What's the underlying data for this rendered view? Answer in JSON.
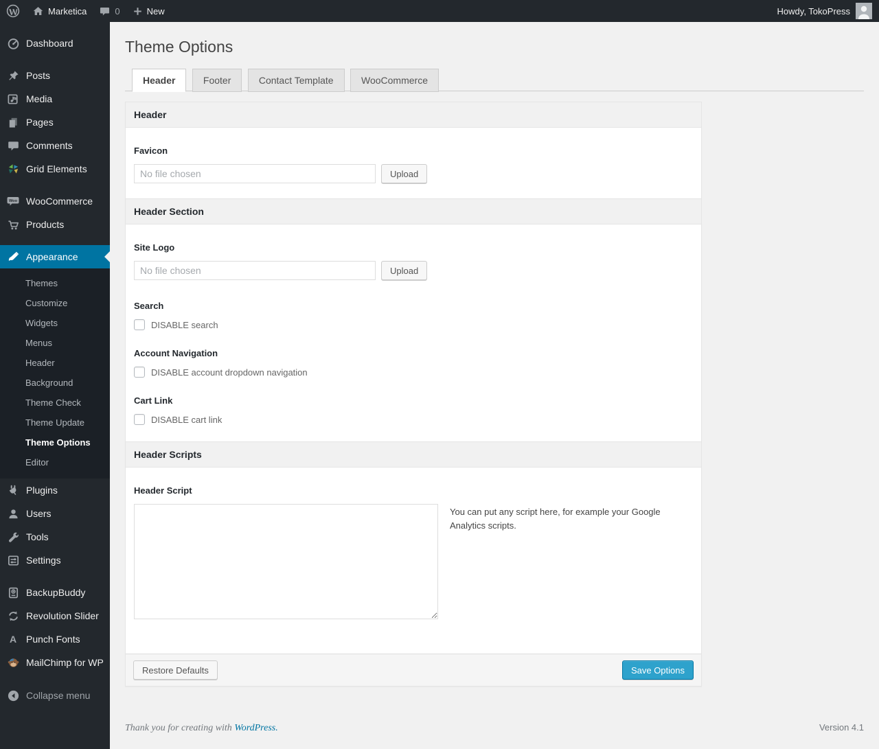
{
  "admin_bar": {
    "site_name": "Marketica",
    "comment_count": "0",
    "new_label": "New",
    "howdy_text": "Howdy, TokoPress"
  },
  "sidebar": {
    "items": [
      {
        "label": "Dashboard"
      },
      {
        "label": "Posts"
      },
      {
        "label": "Media"
      },
      {
        "label": "Pages"
      },
      {
        "label": "Comments"
      },
      {
        "label": "Grid Elements"
      },
      {
        "label": "WooCommerce"
      },
      {
        "label": "Products"
      },
      {
        "label": "Appearance"
      },
      {
        "label": "Plugins"
      },
      {
        "label": "Users"
      },
      {
        "label": "Tools"
      },
      {
        "label": "Settings"
      },
      {
        "label": "BackupBuddy"
      },
      {
        "label": "Revolution Slider"
      },
      {
        "label": "Punch Fonts"
      },
      {
        "label": "MailChimp for WP"
      }
    ],
    "appearance_submenu": [
      "Themes",
      "Customize",
      "Widgets",
      "Menus",
      "Header",
      "Background",
      "Theme Check",
      "Theme Update",
      "Theme Options",
      "Editor"
    ],
    "current_submenu_item": "Theme Options",
    "collapse_label": "Collapse menu"
  },
  "icons": {
    "punch_fonts_glyph": "A"
  },
  "page": {
    "title": "Theme Options",
    "tabs": [
      {
        "label": "Header"
      },
      {
        "label": "Footer"
      },
      {
        "label": "Contact Template"
      },
      {
        "label": "WooCommerce"
      }
    ],
    "active_tab": "Header",
    "panels": {
      "header": {
        "title": "Header",
        "favicon_label": "Favicon",
        "file_placeholder": "No file chosen",
        "upload_label": "Upload"
      },
      "header_section": {
        "title": "Header Section",
        "site_logo_label": "Site Logo",
        "file_placeholder": "No file chosen",
        "upload_label": "Upload",
        "search_label": "Search",
        "search_checkbox_label": "DISABLE search",
        "account_nav_label": "Account Navigation",
        "account_checkbox_label": "DISABLE account dropdown navigation",
        "cart_label": "Cart Link",
        "cart_checkbox_label": "DISABLE cart link"
      },
      "header_scripts": {
        "title": "Header Scripts",
        "script_label": "Header Script",
        "script_value": "",
        "help_text": "You can put any script here, for example your Google Analytics scripts."
      }
    },
    "actions": {
      "restore_label": "Restore Defaults",
      "save_label": "Save Options"
    }
  },
  "page_footer": {
    "thanks_text": "Thank you for creating with",
    "wordpress_link": "WordPress.",
    "version": "Version 4.1"
  },
  "colors": {
    "accent_blue": "#0074a2",
    "primary_button": "#2ea2cc",
    "page_background": "#f1f1f1",
    "admin_dark": "#23282d"
  }
}
